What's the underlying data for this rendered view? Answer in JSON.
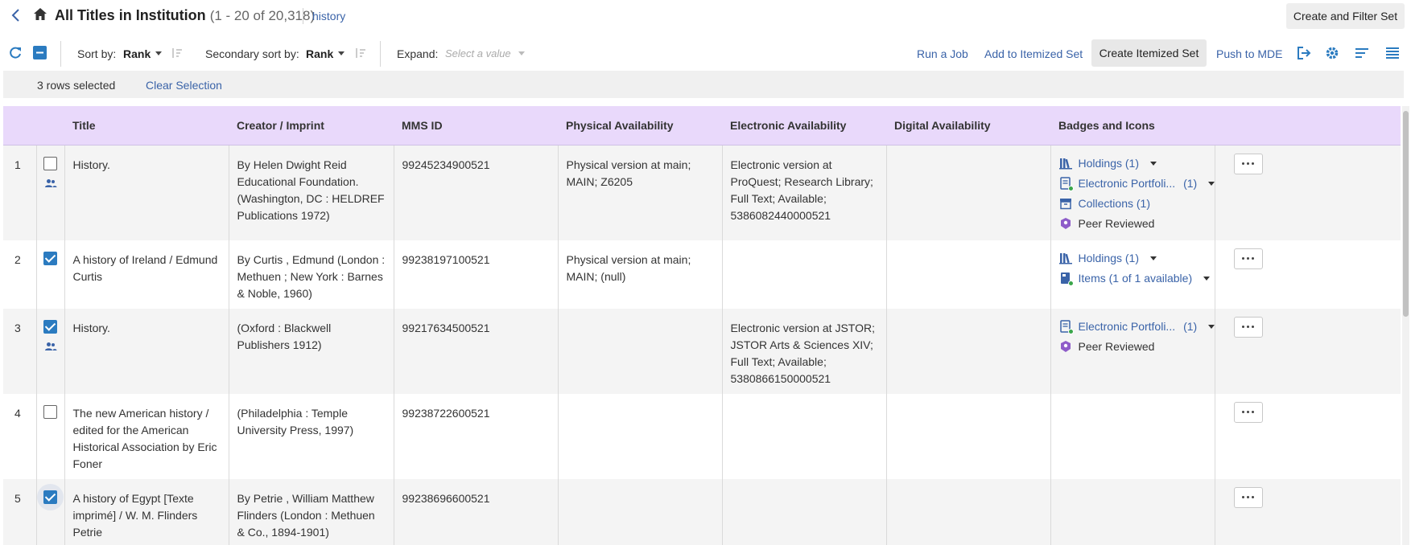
{
  "header": {
    "title": "All Titles in Institution",
    "count_text": "(1 - 20 of 20,318)",
    "search_term": "history",
    "create_filter_set_label": "Create and Filter Set"
  },
  "toolbar": {
    "sort_label": "Sort by:",
    "sort_value": "Rank",
    "secondary_sort_label": "Secondary sort by:",
    "secondary_sort_value": "Rank",
    "expand_label": "Expand:",
    "expand_placeholder": "Select a value",
    "run_job": "Run a Job",
    "add_itemized": "Add to Itemized Set",
    "create_itemized": "Create Itemized Set",
    "push_mde": "Push to MDE"
  },
  "selection": {
    "text": "3 rows selected",
    "clear_label": "Clear Selection"
  },
  "columns": [
    "Title",
    "Creator / Imprint",
    "MMS ID",
    "Physical Availability",
    "Electronic Availability",
    "Digital Availability",
    "Badges and Icons"
  ],
  "rows": [
    {
      "num": "1",
      "checked": false,
      "group_icon": true,
      "title": "History.",
      "creator": "By Helen Dwight Reid Educational Foundation. (Washington, DC : HELDREF Publications 1972)",
      "mms": "99245234900521",
      "physical": "Physical version at main; MAIN; Z6205",
      "electronic": "Electronic version at ProQuest; Research Library; Full Text; Available; 5386082440000521",
      "digital": "",
      "badges": [
        {
          "icon": "holdings",
          "label": "Holdings (1)",
          "count": "",
          "caret": true
        },
        {
          "icon": "portfolio",
          "label": "Electronic Portfoli...",
          "count": "(1)",
          "caret": true
        },
        {
          "icon": "collections",
          "label": "Collections (1)",
          "count": "",
          "caret": false
        },
        {
          "icon": "peer",
          "label": "Peer Reviewed",
          "count": "",
          "caret": false
        }
      ]
    },
    {
      "num": "2",
      "checked": true,
      "group_icon": false,
      "title": "A history of Ireland / Edmund Curtis",
      "creator": "By Curtis , Edmund (London : Methuen ; New York : Barnes & Noble, 1960)",
      "mms": "99238197100521",
      "physical": "Physical version at main; MAIN; (null)",
      "electronic": "",
      "digital": "",
      "badges": [
        {
          "icon": "holdings",
          "label": "Holdings (1)",
          "count": "",
          "caret": true
        },
        {
          "icon": "items",
          "label": "Items (1 of 1 available)",
          "count": "",
          "caret": true
        }
      ]
    },
    {
      "num": "3",
      "checked": true,
      "group_icon": true,
      "title": "History.",
      "creator": "(Oxford : Blackwell Publishers 1912)",
      "mms": "99217634500521",
      "physical": "",
      "electronic": "Electronic version at JSTOR; JSTOR Arts & Sciences XIV; Full Text; Available; 5380866150000521",
      "digital": "",
      "badges": [
        {
          "icon": "portfolio",
          "label": "Electronic Portfoli...",
          "count": "(1)",
          "caret": true
        },
        {
          "icon": "peer",
          "label": "Peer Reviewed",
          "count": "",
          "caret": false
        }
      ]
    },
    {
      "num": "4",
      "checked": false,
      "group_icon": false,
      "title": "The new American history / edited for the American Historical Association by Eric Foner",
      "creator": "(Philadelphia : Temple University Press, 1997)",
      "mms": "99238722600521",
      "physical": "",
      "electronic": "",
      "digital": "",
      "badges": []
    },
    {
      "num": "5",
      "checked": true,
      "focused": true,
      "group_icon": false,
      "title": "A history of Egypt [Texte imprimé] / W. M. Flinders Petrie",
      "creator": "By Petrie , William Matthew Flinders (London : Methuen & Co., 1894-1901)",
      "mms": "99238696600521",
      "physical": "",
      "electronic": "",
      "digital": "",
      "badges": []
    }
  ],
  "colors": {
    "accent": "#3a63a8",
    "header_bg": "#e9d9fb",
    "checkbox": "#2b7bc0",
    "green": "#3aa64a",
    "purple": "#8e5cc9"
  }
}
